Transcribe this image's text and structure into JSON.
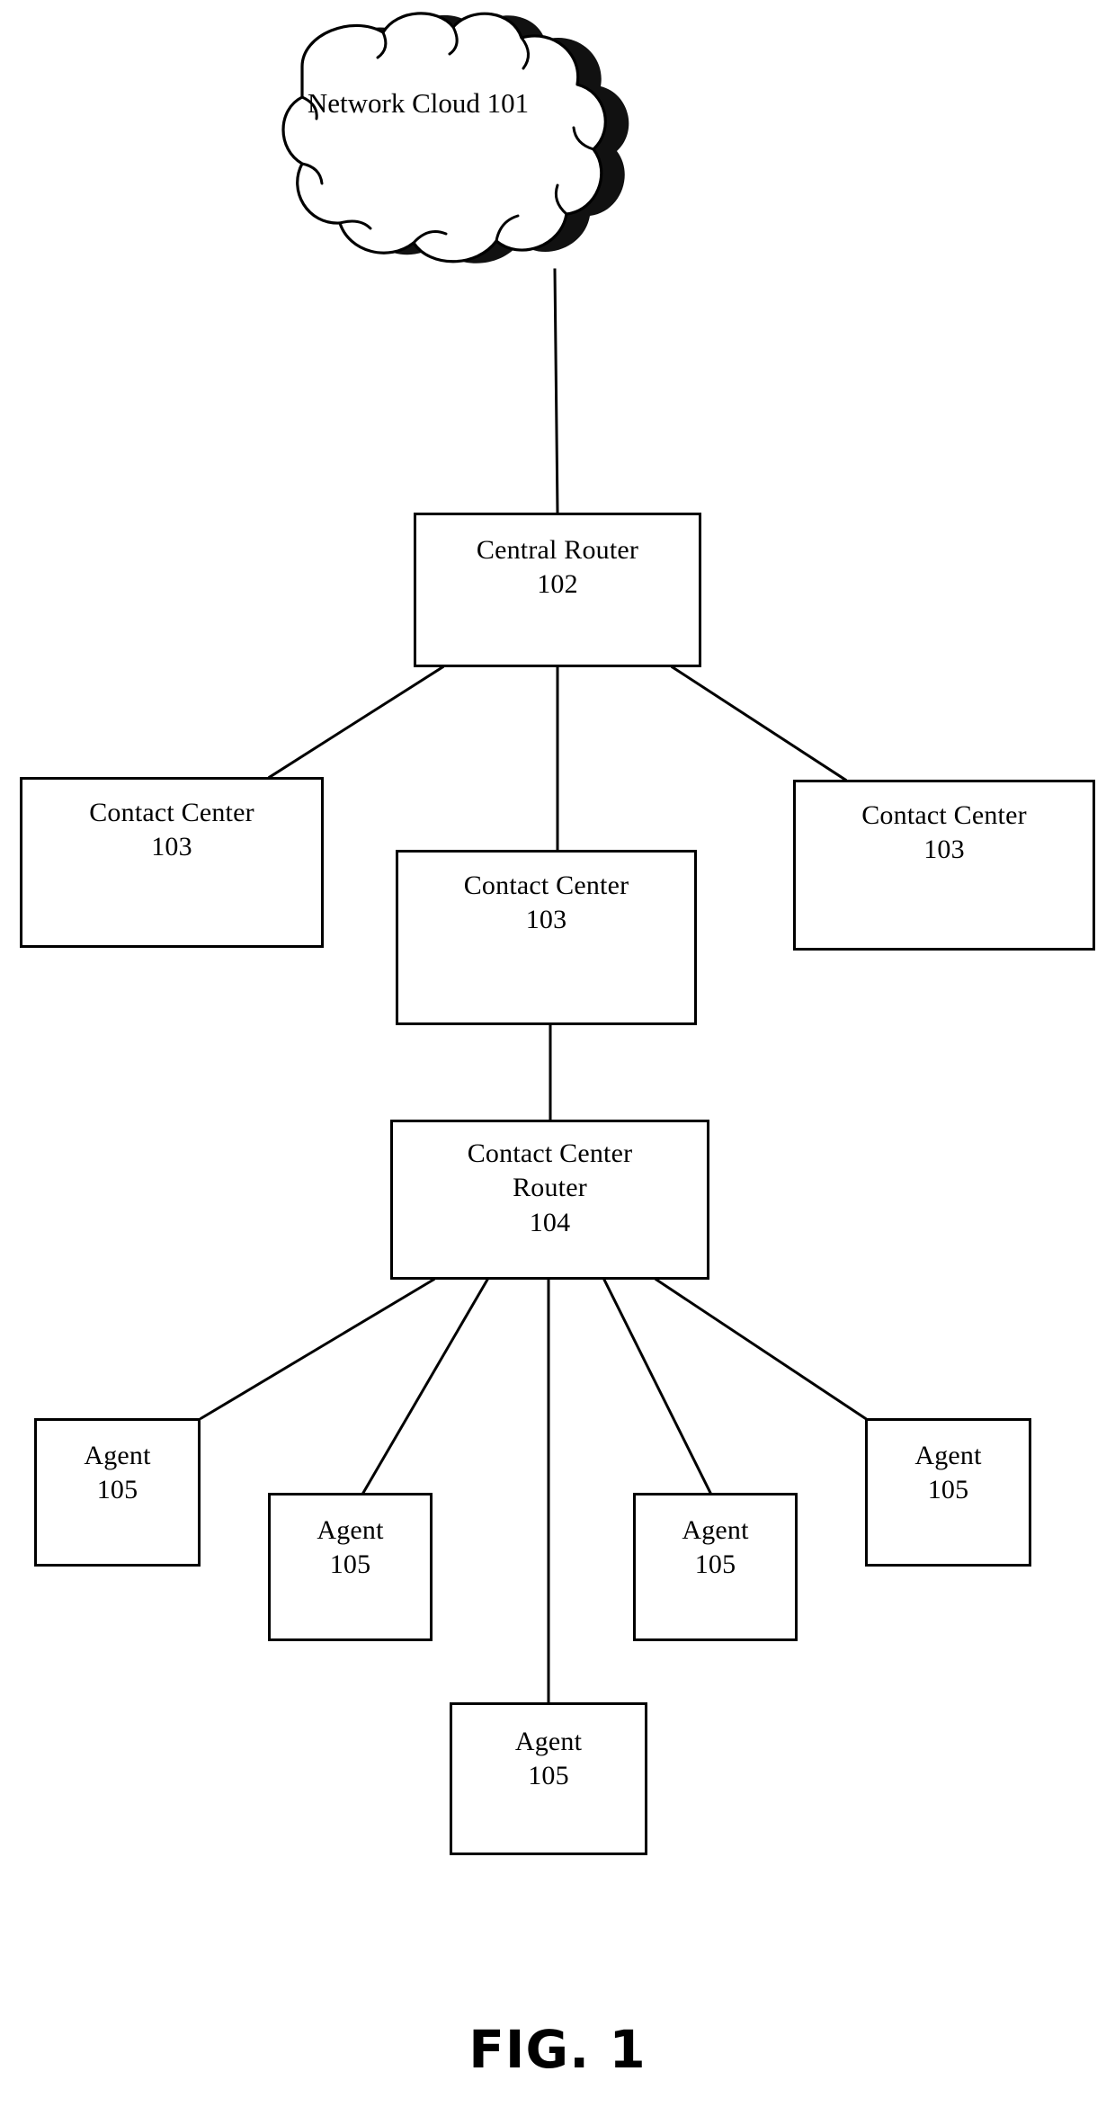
{
  "figure": {
    "caption": "FIG. 1",
    "colors": {
      "stroke": "#000000",
      "background": "#ffffff",
      "shadow": "#1a1a1a"
    }
  },
  "nodes": {
    "network_cloud": {
      "label": "Network Cloud",
      "ref": "101",
      "shape": "cloud"
    },
    "central_router": {
      "label": "Central Router",
      "ref": "102",
      "shape": "rectangle"
    },
    "contact_center_left": {
      "label": "Contact Center",
      "ref": "103",
      "shape": "rectangle"
    },
    "contact_center_mid": {
      "label": "Contact Center",
      "ref": "103",
      "shape": "rectangle"
    },
    "contact_center_right": {
      "label": "Contact Center",
      "ref": "103",
      "shape": "rectangle"
    },
    "contact_center_router": {
      "label_line1": "Contact Center",
      "label_line2": "Router",
      "ref": "104",
      "shape": "rectangle"
    },
    "agent_1": {
      "label": "Agent",
      "ref": "105",
      "shape": "rectangle"
    },
    "agent_2": {
      "label": "Agent",
      "ref": "105",
      "shape": "rectangle"
    },
    "agent_3": {
      "label": "Agent",
      "ref": "105",
      "shape": "rectangle"
    },
    "agent_4": {
      "label": "Agent",
      "ref": "105",
      "shape": "rectangle"
    },
    "agent_5": {
      "label": "Agent",
      "ref": "105",
      "shape": "rectangle"
    }
  },
  "connections": [
    {
      "from": "network_cloud",
      "to": "central_router"
    },
    {
      "from": "central_router",
      "to": "contact_center_left"
    },
    {
      "from": "central_router",
      "to": "contact_center_mid"
    },
    {
      "from": "central_router",
      "to": "contact_center_right"
    },
    {
      "from": "contact_center_mid",
      "to": "contact_center_router"
    },
    {
      "from": "contact_center_router",
      "to": "agent_1"
    },
    {
      "from": "contact_center_router",
      "to": "agent_2"
    },
    {
      "from": "contact_center_router",
      "to": "agent_3"
    },
    {
      "from": "contact_center_router",
      "to": "agent_4"
    },
    {
      "from": "contact_center_router",
      "to": "agent_5"
    }
  ]
}
